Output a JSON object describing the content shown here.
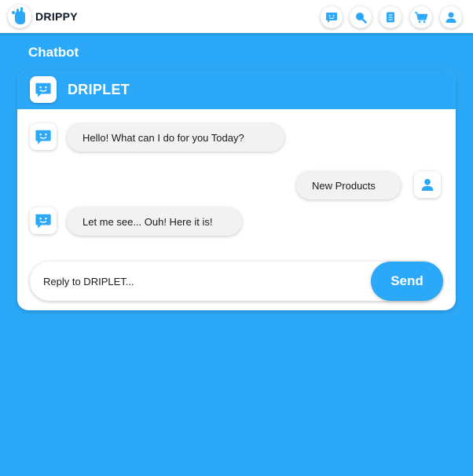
{
  "app": {
    "brand": "DRIPPY",
    "accent_color": "#2ba8f7"
  },
  "nav": {
    "icons": [
      "chat-icon",
      "search-icon",
      "document-icon",
      "cart-icon",
      "user-icon"
    ]
  },
  "page": {
    "title": "Chatbot"
  },
  "chat": {
    "bot_name": "DRIPPY",
    "header_name": "DRIPLET",
    "messages": [
      {
        "sender": "bot",
        "text": "Hello! What can I do for you Today?"
      },
      {
        "sender": "user",
        "text": "New Products"
      },
      {
        "sender": "bot",
        "text": "Let me see... Ouh! Here it is!"
      }
    ],
    "reply_placeholder": "Reply to DRIPLET...",
    "send_label": "Send"
  }
}
